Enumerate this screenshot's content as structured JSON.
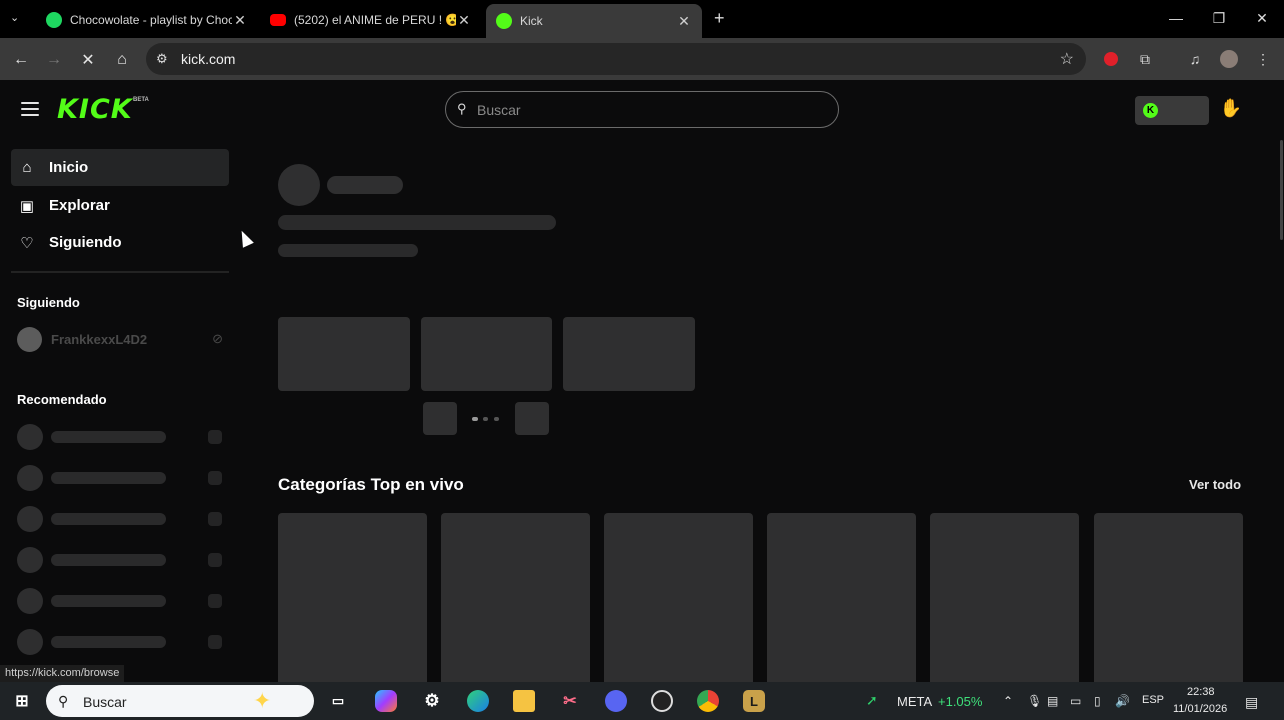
{
  "browser": {
    "tabs": [
      {
        "title": "Chocowolate - playlist by Choc",
        "favicon": "spotify-icon",
        "color": "#1ed760"
      },
      {
        "title": "(5202) el ANIME de PERU ! 😮",
        "favicon": "youtube-icon",
        "color": "#ff0000"
      },
      {
        "title": "Kick",
        "favicon": "kick-icon",
        "color": "#53fc18"
      }
    ],
    "new_tab": "+",
    "url": "kick.com",
    "status_url": "https://kick.com/browse"
  },
  "kick": {
    "logo": "KICK",
    "logo_badge": "BETA",
    "search_placeholder": "Buscar",
    "accent": "#53fc18",
    "nav": [
      {
        "label": "Inicio",
        "icon": "home-icon"
      },
      {
        "label": "Explorar",
        "icon": "explore-icon"
      },
      {
        "label": "Siguiendo",
        "icon": "heart-icon"
      }
    ],
    "following_title": "Siguiendo",
    "following_user": "FrankkexxL4D2",
    "recommended_title": "Recomendado",
    "categories_title": "Categorías Top en vivo",
    "see_all": "Ver todo"
  },
  "taskbar": {
    "search": "Buscar",
    "stock_name": "META",
    "stock_change": "+1.05%",
    "language": "ESP",
    "time": "22:38",
    "date": "11/01/2026"
  }
}
